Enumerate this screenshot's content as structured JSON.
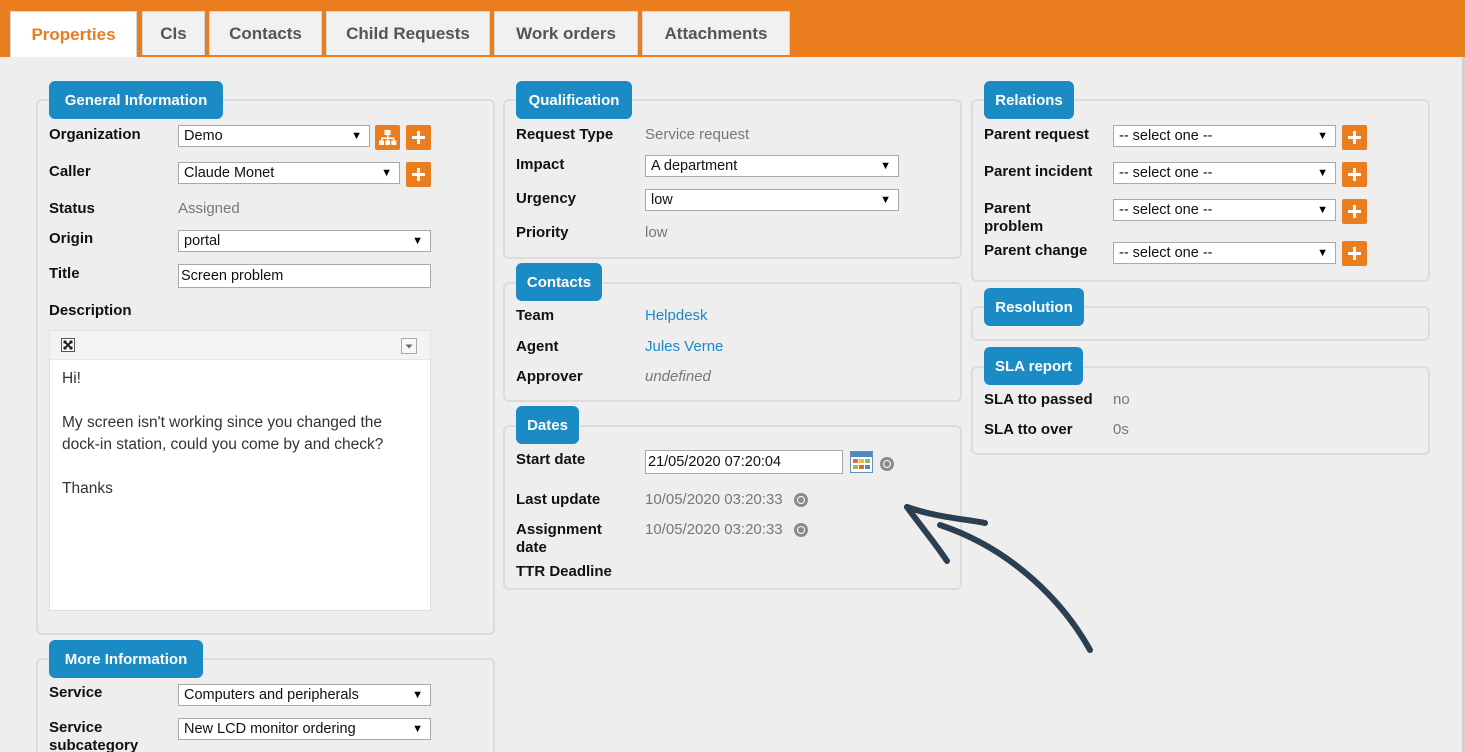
{
  "tabs": [
    "Properties",
    "CIs",
    "Contacts",
    "Child Requests",
    "Work orders",
    "Attachments"
  ],
  "general": {
    "legend": "General Information",
    "organization_label": "Organization",
    "organization_value": "Demo",
    "caller_label": "Caller",
    "caller_value": "Claude Monet",
    "status_label": "Status",
    "status_value": "Assigned",
    "origin_label": "Origin",
    "origin_value": "portal",
    "title_label": "Title",
    "title_value": "Screen problem",
    "description_label": "Description",
    "description_lines": [
      "Hi!",
      "",
      "My screen isn't working since you changed the",
      "dock-in station, could you come by and check?",
      "",
      "Thanks"
    ]
  },
  "more": {
    "legend": "More Information",
    "service_label": "Service",
    "service_value": "Computers and peripherals",
    "subcat_label_1": "Service",
    "subcat_label_2": "subcategory",
    "subcat_value": "New LCD monitor ordering"
  },
  "qualification": {
    "legend": "Qualification",
    "request_type_label": "Request Type",
    "request_type_value": "Service request",
    "impact_label": "Impact",
    "impact_value": "A department",
    "urgency_label": "Urgency",
    "urgency_value": "low",
    "priority_label": "Priority",
    "priority_value": "low"
  },
  "contacts": {
    "legend": "Contacts",
    "team_label": "Team",
    "team_value": "Helpdesk",
    "agent_label": "Agent",
    "agent_value": "Jules Verne",
    "approver_label": "Approver",
    "approver_value": "undefined"
  },
  "dates": {
    "legend": "Dates",
    "start_label": "Start date",
    "start_value": "21/05/2020 07:20:04",
    "last_update_label": "Last update",
    "last_update_value": "10/05/2020 03:20:33",
    "assignment_label_1": "Assignment",
    "assignment_label_2": "date",
    "assignment_value": "10/05/2020 03:20:33",
    "ttr_label": "TTR Deadline"
  },
  "relations": {
    "legend": "Relations",
    "parent_request_label": "Parent request",
    "parent_incident_label": "Parent incident",
    "parent_problem_label_1": "Parent",
    "parent_problem_label_2": "problem",
    "parent_change_label": "Parent change",
    "select_placeholder": "-- select one --"
  },
  "resolution": {
    "legend": "Resolution"
  },
  "sla": {
    "legend": "SLA report",
    "tto_passed_label": "SLA tto passed",
    "tto_passed_value": "no",
    "tto_over_label": "SLA tto over",
    "tto_over_value": "0s"
  },
  "colors": {
    "accent": "#ea7d1e",
    "legend": "#1a8bc5",
    "link": "#1a8bc5",
    "arrow": "#2b3f50"
  },
  "icons": [
    "hierarchy-icon",
    "plus-icon",
    "calendar-icon",
    "globe-icon",
    "maximize-icon",
    "dropdown-icon"
  ]
}
